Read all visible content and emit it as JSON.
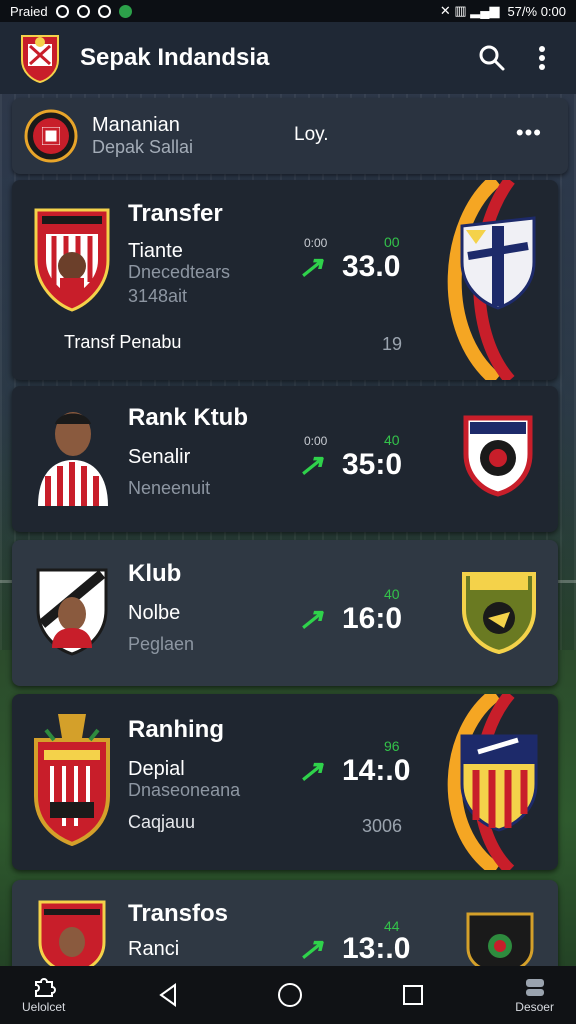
{
  "status": {
    "left": "Praied",
    "right": "57/% 0:00"
  },
  "app": {
    "title": "Sepak Indandsia"
  },
  "header_card": {
    "name": "Mananian",
    "sub": "Depak Sallai",
    "mid": "Loy."
  },
  "cards": [
    {
      "title": "Transfer",
      "line1": "Tiante",
      "line2": "Dnecedtears",
      "line3": "3148ait",
      "tag_small": "0:00",
      "tag_green": "00",
      "score": "33.0",
      "footer_left": "Transf Penabu",
      "footer_right": "19"
    },
    {
      "title": "Rank Ktub",
      "line1": "Senalir",
      "line2": "Neneenuit",
      "tag_small": "0:00",
      "tag_green": "40",
      "score": "35:0"
    },
    {
      "title": "Klub",
      "line1": "Nolbe",
      "line2": "Peglaen",
      "tag_green": "40",
      "score": "16:0"
    },
    {
      "title": "Ranhing",
      "line1": "Depial",
      "line2": "Dnaseoneana",
      "line3": "Caqjauu",
      "tag_green": "96",
      "score": "14:.0",
      "footer_right": "3006"
    },
    {
      "title": "Transfos",
      "line1": "Ranci",
      "tag_green": "44",
      "score": "13:.0"
    }
  ],
  "nav": {
    "left_label": "Uelolcet",
    "right_label": "Desoer"
  },
  "colors": {
    "accent_green": "#2fd24b",
    "appbar": "#1f2835",
    "card": "#1f2630"
  },
  "icons": [
    "search-icon",
    "more-vert-icon",
    "back-icon",
    "home-icon",
    "recents-icon"
  ]
}
